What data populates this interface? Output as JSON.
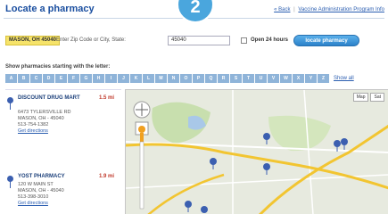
{
  "header": {
    "title": "Locate a pharmacy",
    "back_link": "« Back",
    "separator": "|",
    "vaccine_link": "Vaccine Administration Program Info"
  },
  "step_badge": "2",
  "search": {
    "current_location": "MASON, OH 45040",
    "prompt": "Enter Zip Code or City, State:",
    "input_value": "45040",
    "open24_label": "Open 24 hours",
    "open24_checked": false,
    "locate_button": "locate pharmacy"
  },
  "letters": {
    "label": "Show pharmacies starting with the letter:",
    "items": [
      "A",
      "B",
      "C",
      "D",
      "E",
      "F",
      "G",
      "H",
      "I",
      "J",
      "K",
      "L",
      "M",
      "N",
      "O",
      "P",
      "Q",
      "R",
      "S",
      "T",
      "U",
      "V",
      "W",
      "X",
      "Y",
      "Z"
    ],
    "show_all": "Show all"
  },
  "results": [
    {
      "name": "DISCOUNT DRUG MART",
      "distance": "1.5 mi",
      "address": "6473 TYLERSVILLE RD",
      "city": "MASON, OH - 45040",
      "phone": "513-754-1382",
      "directions": "Get directions"
    },
    {
      "name": "YOST PHARMACY",
      "distance": "1.9 mi",
      "address": "120 W MAIN ST",
      "city": "MASON, OH - 45040",
      "phone": "513-398-3010",
      "directions": "Get directions"
    }
  ],
  "map": {
    "type_buttons": [
      "Map",
      "Sat"
    ],
    "colors": {
      "land": "#e7eadf",
      "highway": "#f2c531",
      "road": "#ffffff",
      "park": "#c8dfae",
      "water": "#a9c8e8",
      "pin": "#3b5fb0",
      "pegman": "#f0a020"
    }
  },
  "colors": {
    "accent": "#4aa6dd",
    "title": "#1b4fa0",
    "link": "#2a5db0",
    "distance": "#c0392b",
    "chip": "#f6e36a"
  }
}
